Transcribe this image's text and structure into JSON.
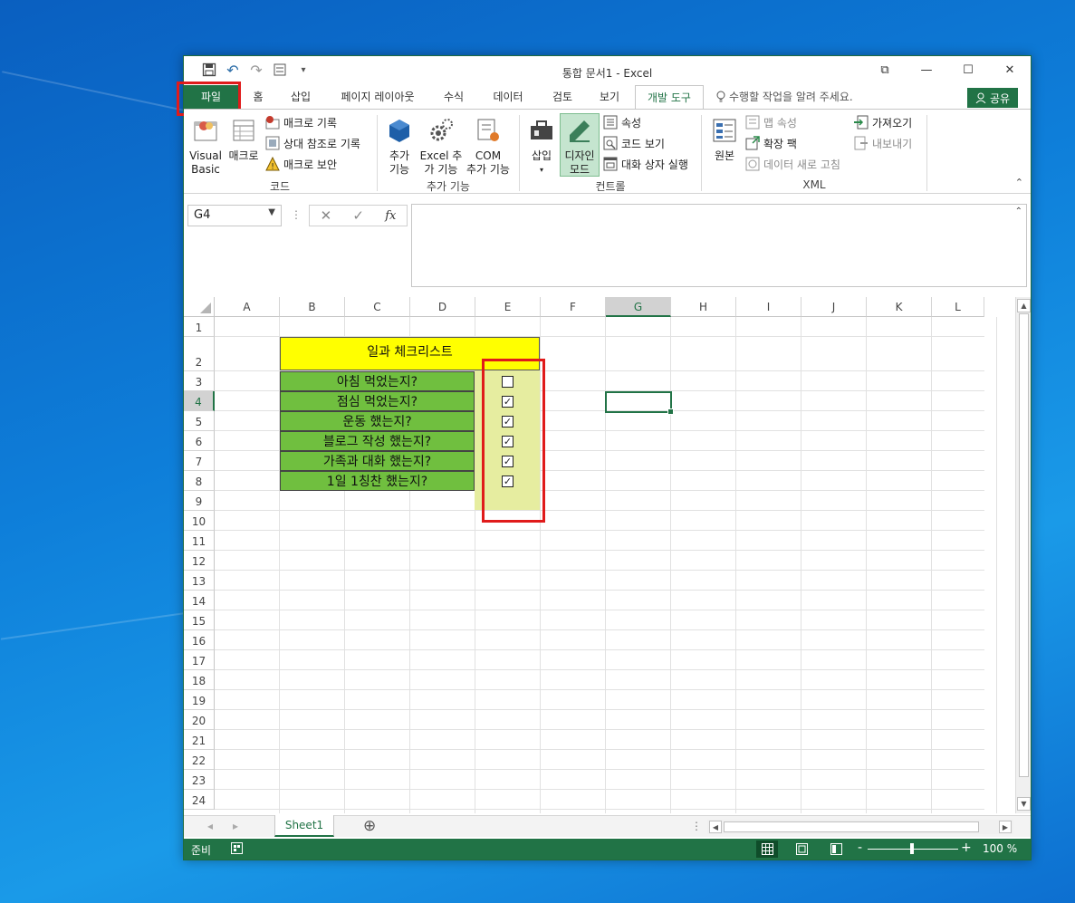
{
  "window": {
    "title": "통합 문서1  -  Excel",
    "controls": {
      "minimize": "—",
      "maximize": "☐",
      "close": "✕",
      "ribbon_display": "⧉"
    },
    "qat": {
      "save": "💾",
      "undo": "↶",
      "redo": "↷",
      "more": "▾"
    }
  },
  "tabs": [
    {
      "label": "파일"
    },
    {
      "label": "홈"
    },
    {
      "label": "삽입"
    },
    {
      "label": "페이지 레이아웃"
    },
    {
      "label": "수식"
    },
    {
      "label": "데이터"
    },
    {
      "label": "검토"
    },
    {
      "label": "보기"
    },
    {
      "label": "개발 도구"
    }
  ],
  "tell_me": "수행할 작업을 알려 주세요.",
  "share": "공유",
  "ribbon": {
    "code": {
      "visual_basic": [
        "Visual",
        "Basic"
      ],
      "macro": "매크로",
      "record_macro": "매크로 기록",
      "relative_ref": "상대 참조로 기록",
      "macro_security": "매크로 보안",
      "label": "코드"
    },
    "addins": {
      "addins": [
        "추가",
        "기능"
      ],
      "excel_addins": [
        "Excel 추",
        "가 기능"
      ],
      "com_addins": [
        "COM",
        "추가 기능"
      ],
      "label": "추가 기능"
    },
    "controls": {
      "insert": "삽입",
      "design_mode": [
        "디자인",
        "모드"
      ],
      "properties": "속성",
      "view_code": "코드 보기",
      "run_dialog": "대화 상자 실행",
      "label": "컨트롤"
    },
    "xml": {
      "source": "원본",
      "map_properties": "맵 속성",
      "expansion_packs": "확장 팩",
      "refresh_data": "데이터 새로 고침",
      "import": "가져오기",
      "export": "내보내기",
      "label": "XML"
    }
  },
  "formula_bar": {
    "name_box": "G4",
    "fx": "fx",
    "cancel": "✕",
    "enter": "✓",
    "formula": ""
  },
  "grid": {
    "columns": [
      "A",
      "B",
      "C",
      "D",
      "E",
      "F",
      "G",
      "H",
      "I",
      "J",
      "K",
      "L"
    ],
    "rows": [
      "1",
      "2",
      "3",
      "4",
      "5",
      "6",
      "7",
      "8",
      "9",
      "10",
      "11",
      "12",
      "13",
      "14",
      "15",
      "16",
      "17",
      "18",
      "19",
      "20",
      "21",
      "22",
      "23",
      "24"
    ],
    "selected_cell": "G4",
    "checklist_title": "일과 체크리스트",
    "items": [
      {
        "text": "아침 먹었는지?",
        "checked": false
      },
      {
        "text": "점심 먹었는지?",
        "checked": true
      },
      {
        "text": "운동 했는지?",
        "checked": true
      },
      {
        "text": "블로그 작성 했는지?",
        "checked": true
      },
      {
        "text": "가족과 대화 했는지?",
        "checked": true
      },
      {
        "text": "1일 1칭찬 했는지?",
        "checked": true
      }
    ],
    "check_mark": "✓"
  },
  "sheet_tabs": {
    "sheets": [
      "Sheet1"
    ],
    "add": "⊕",
    "prev": "◂",
    "next": "▸"
  },
  "status": {
    "ready": "준비",
    "zoom": "100 %",
    "zoom_minus": "-",
    "zoom_plus": "+"
  },
  "colors": {
    "excel_green": "#217346",
    "title_yellow": "#ffff00",
    "item_green": "#70bf3f",
    "check_bg": "#e6eda0",
    "highlight_red": "#e01b1b"
  }
}
